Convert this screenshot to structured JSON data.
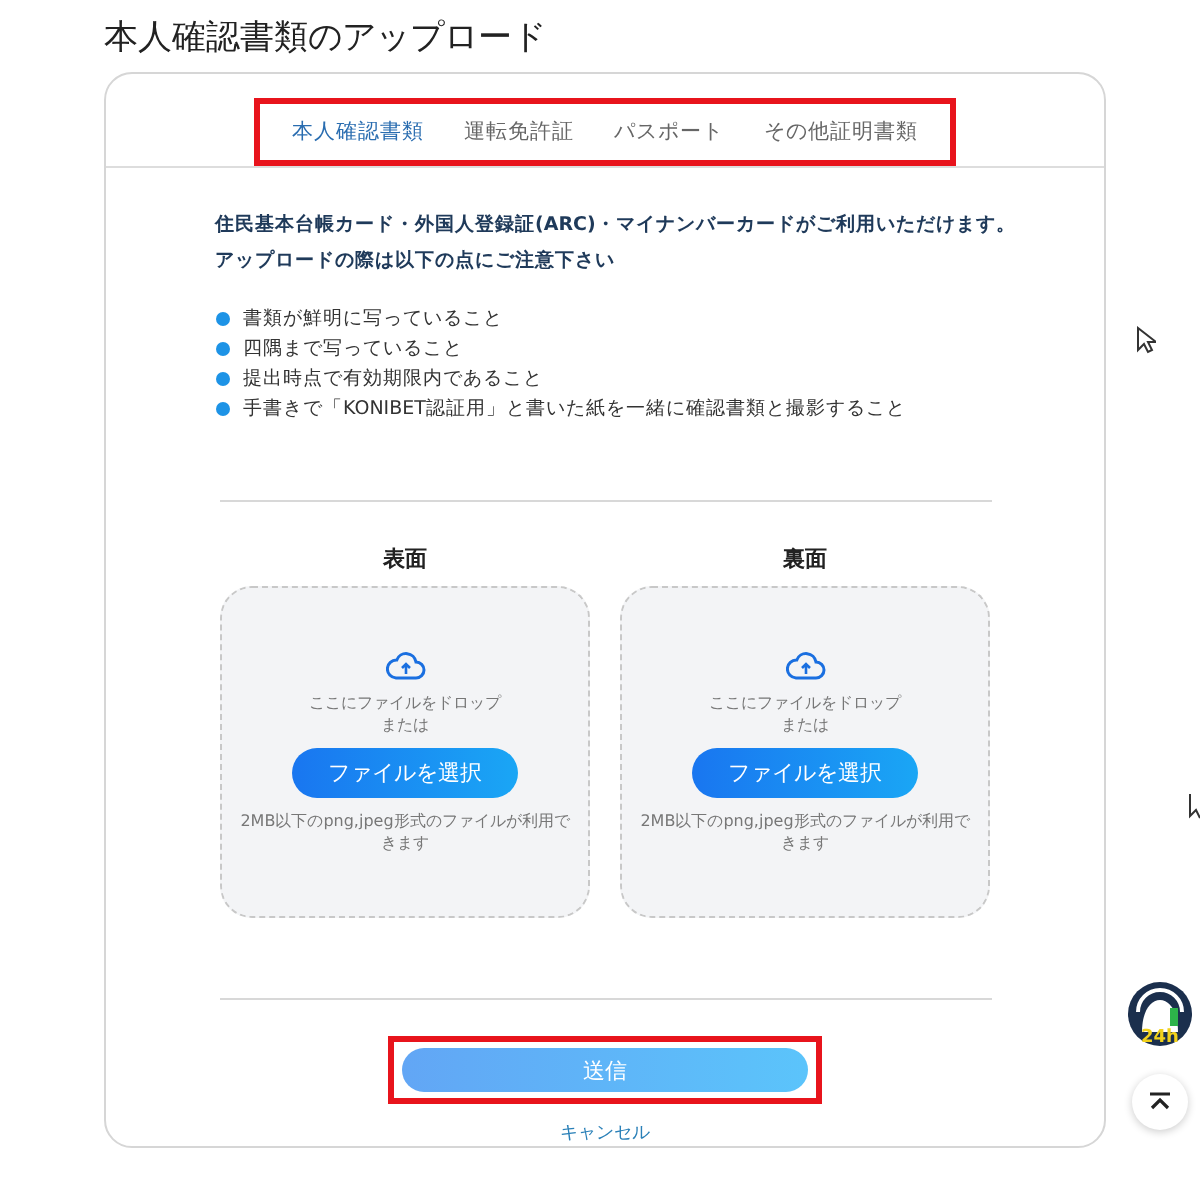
{
  "title": "本人確認書類のアップロード",
  "tabs_highlighted": true,
  "tabs": [
    {
      "label": "本人確認書類",
      "selected": true
    },
    {
      "label": "運転免許証",
      "selected": false
    },
    {
      "label": "パスポート",
      "selected": false
    },
    {
      "label": "その他証明書類",
      "selected": false
    }
  ],
  "intro": [
    "住民基本台帳カード・外国人登録証(ARC)・マイナンバーカードがご利用いただけます。",
    "アップロードの際は以下の点にご注意下さい"
  ],
  "notes": [
    "書類が鮮明に写っていること",
    "四隅まで写っていること",
    "提出時点で有効期限内であること",
    "手書きで「KONIBET認証用」と書いた紙を一緒に確認書類と撮影すること"
  ],
  "uploads": [
    {
      "label": "表面",
      "drop_text": "ここにファイルをドロップ",
      "or_text": "または",
      "button": "ファイルを選択",
      "hint": "2MB以下のpng,jpeg形式のファイルが利用できます"
    },
    {
      "label": "裏面",
      "drop_text": "ここにファイルをドロップ",
      "or_text": "または",
      "button": "ファイルを選択",
      "hint": "2MB以下のpng,jpeg形式のファイルが利用できます"
    }
  ],
  "submit": {
    "label": "送信",
    "highlighted": true
  },
  "cancel": "キャンセル",
  "support_badge": "24h"
}
